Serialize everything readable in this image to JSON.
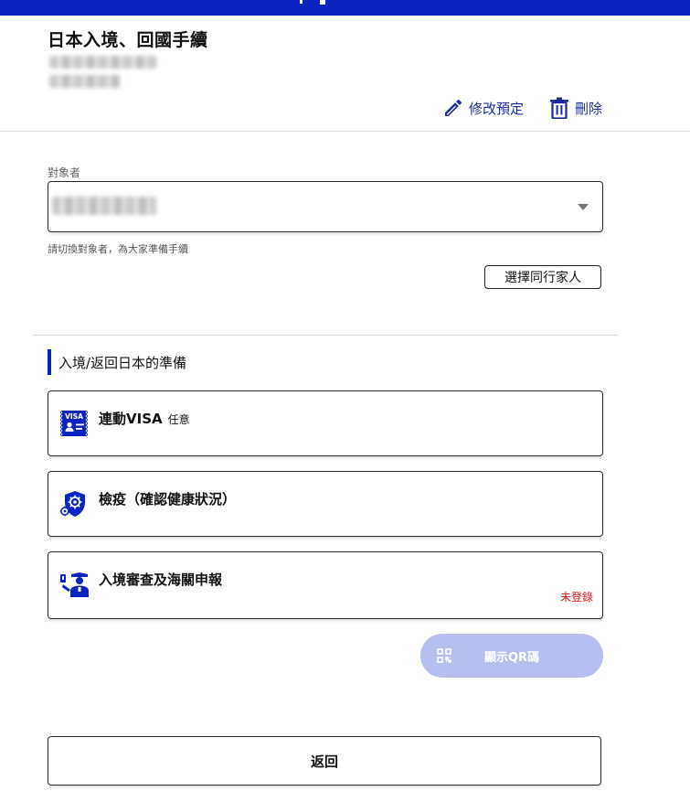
{
  "header": {
    "title": "日本入境、回國手續",
    "actions": {
      "edit_label": "修改預定",
      "delete_label": "刪除"
    }
  },
  "target_person": {
    "label": "對象者",
    "helper_text": "請切換對象者，為大家準備手續",
    "companion_button_label": "選擇同行家人"
  },
  "section": {
    "title": "入境/返回日本的準備",
    "cards": [
      {
        "label": "連動VISA",
        "tag": "任意",
        "icon": "visa-icon",
        "status": ""
      },
      {
        "label": "檢疫（確認健康狀況）",
        "tag": "",
        "icon": "quarantine-shield-icon",
        "status": ""
      },
      {
        "label": "入境審查及海關申報",
        "tag": "",
        "icon": "immigration-officer-icon",
        "status": "未登錄"
      }
    ]
  },
  "qr_button": {
    "label": "顯示QR碼",
    "icon": "qr-code-icon"
  },
  "back_button": {
    "label": "返回"
  },
  "colors": {
    "brand": "#0a24c2",
    "link": "#1b2a9e",
    "status_warning": "#d11a1a",
    "disabled_button": "#b7bff0"
  }
}
